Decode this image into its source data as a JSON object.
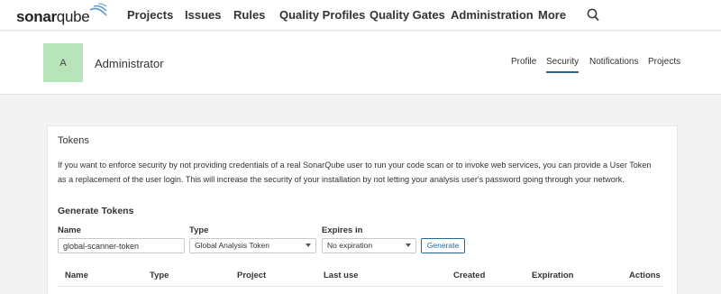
{
  "app": {
    "logo_bold": "sonar",
    "logo_light": "qube"
  },
  "nav": {
    "items": [
      "Projects",
      "Issues",
      "Rules",
      "Quality Profiles",
      "Quality Gates",
      "Administration",
      "More"
    ],
    "search_icon": "search-icon"
  },
  "account": {
    "avatar_letter": "A",
    "avatar_color": "#b7e4b8",
    "name": "Administrator",
    "tabs": [
      "Profile",
      "Security",
      "Notifications",
      "Projects"
    ],
    "active_tab": "Security"
  },
  "tokens": {
    "title": "Tokens",
    "description": "If you want to enforce security by not providing credentials of a real SonarQube user to run your code scan or to invoke web services, you can provide a User Token as a replacement of the user login. This will increase the security of your installation by not letting your analysis user's password going through your network.",
    "generate_title": "Generate Tokens",
    "name_label": "Name",
    "name_value": "global-scanner-token",
    "type_label": "Type",
    "type_value": "Global Analysis Token",
    "expires_label": "Expires in",
    "expires_value": "No expiration",
    "generate_button": "Generate",
    "columns": [
      "Name",
      "Type",
      "Project",
      "Last use",
      "Created",
      "Expiration",
      "Actions"
    ]
  },
  "colors": {
    "accent": "#236a97",
    "page_bg": "#f3f3f3"
  }
}
